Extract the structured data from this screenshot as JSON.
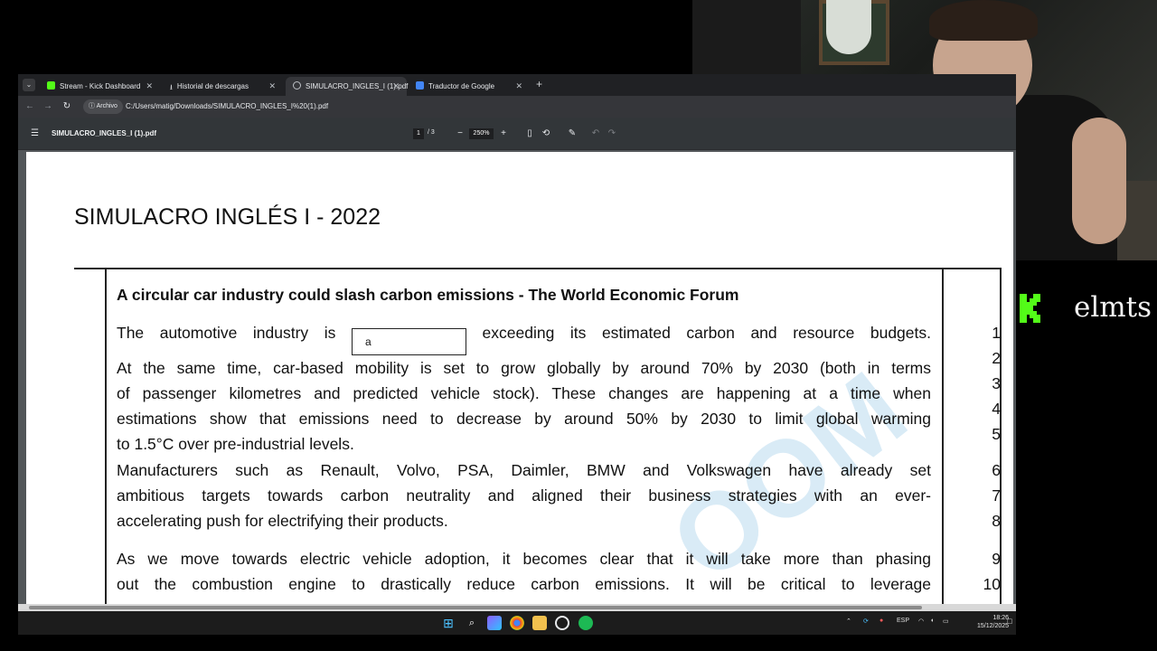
{
  "browser": {
    "tabs": [
      {
        "label": "Stream - Kick Dashboard",
        "icon": "kick-icon",
        "active": false
      },
      {
        "label": "Historial de descargas",
        "icon": "download-icon",
        "active": false
      },
      {
        "label": "SIMULACRO_INGLES_I (1).pdf",
        "icon": "globe-icon",
        "active": true
      },
      {
        "label": "Traductor de Google",
        "icon": "translate-icon",
        "active": false
      }
    ],
    "address_chip": "Archivo",
    "url": "C:/Users/matig/Downloads/SIMULACRO_INGLES_I%20(1).pdf"
  },
  "pdf_toolbar": {
    "filename": "SIMULACRO_INGLES_I (1).pdf",
    "current_page": "1",
    "total_pages": "/ 3",
    "zoom": "250%"
  },
  "document": {
    "title": "SIMULACRO INGLÉS I - 2022",
    "article_title": "A circular car industry could slash carbon emissions - The World Economic Forum",
    "blank_answer": "a",
    "paragraphs": [
      {
        "first_line_start": "The  automotive industry is",
        "first_line_end": "exceeding its  estimated carbon and resource budgets.",
        "lines": [
          "At the same time, car-based mobility is set to grow globally by around 70% by 2030 (both in terms",
          "of passenger kilometres and predicted vehicle stock). These changes are happening at a time when",
          "estimations show that emissions need to decrease by around 50% by 2030 to limit global warming",
          "to 1.5°C over pre-industrial levels."
        ]
      },
      {
        "lines": [
          "Manufacturers such as Renault, Volvo, PSA, Daimler, BMW and Volkswagen have already set",
          "ambitious targets towards carbon neutrality and aligned their business strategies with an ever-",
          "accelerating push for electrifying their products."
        ]
      },
      {
        "lines": [
          "As we move towards electric vehicle adoption, it becomes clear that it will take more than phasing",
          "out the combustion engine to drastically reduce carbon emissions. It will be critical to leverage"
        ]
      }
    ],
    "line_numbers": [
      "1",
      "2",
      "3",
      "4",
      "5",
      "6",
      "7",
      "8",
      "9",
      "10"
    ],
    "watermark": "OOM"
  },
  "taskbar": {
    "language": "ESP",
    "time": "18:26",
    "date": "15/12/2025"
  },
  "overlay": {
    "streamer_name": "elmts"
  },
  "colors": {
    "kick_green": "#53fc18",
    "chrome_dark": "#202124",
    "pdf_toolbar": "#323639",
    "pdf_background": "#525659"
  }
}
